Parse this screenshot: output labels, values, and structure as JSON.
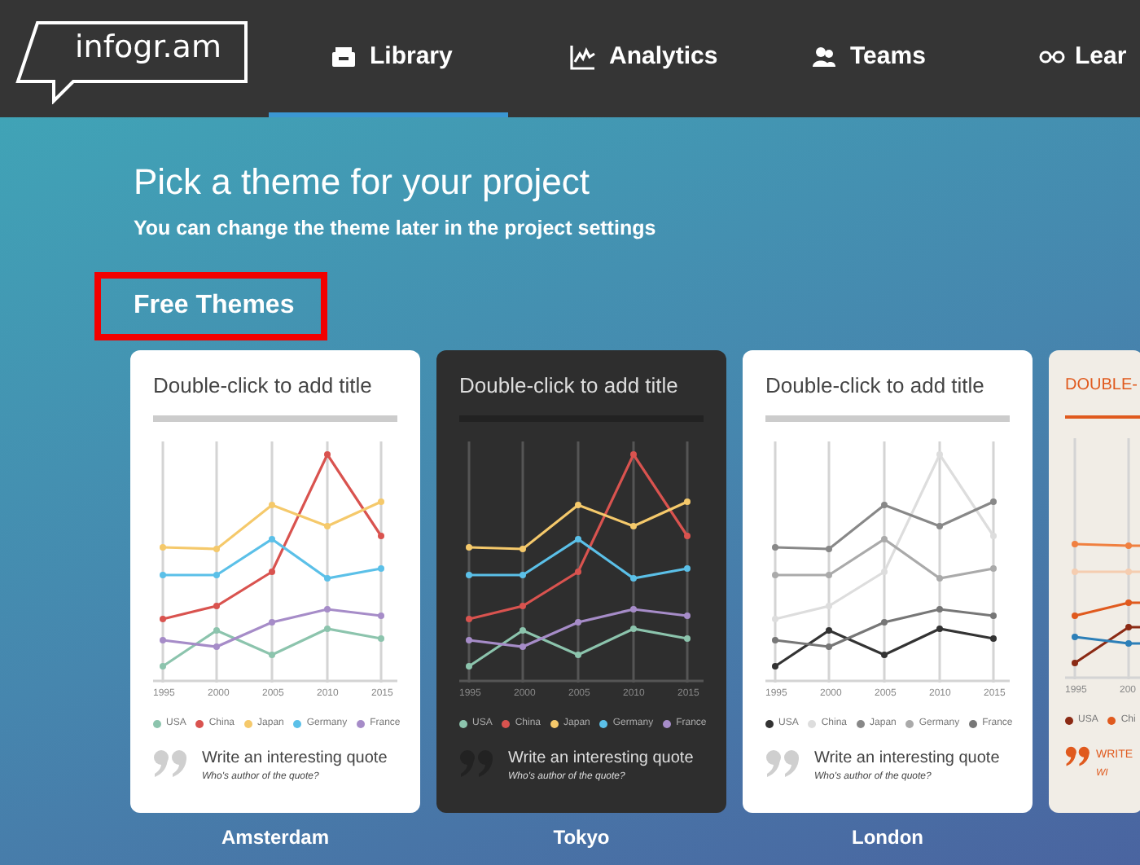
{
  "header": {
    "logo": "infogr.am",
    "nav": [
      {
        "label": "Library",
        "selected": true
      },
      {
        "label": "Analytics",
        "selected": false
      },
      {
        "label": "Teams",
        "selected": false
      },
      {
        "label": "Lear",
        "selected": false
      }
    ]
  },
  "page": {
    "title": "Pick a theme for your project",
    "subtitle": "You can change the theme later in the project settings",
    "section": "Free Themes"
  },
  "themes": [
    {
      "kind": "light",
      "name": "Amsterdam",
      "title": "Double-click to add title",
      "x_ticks": [
        "1995",
        "2000",
        "2005",
        "2010",
        "2015"
      ],
      "legend": [
        {
          "label": "USA",
          "color": "#8cc4ad"
        },
        {
          "label": "China",
          "color": "#d9534f"
        },
        {
          "label": "Japan",
          "color": "#f5c96b"
        },
        {
          "label": "Germany",
          "color": "#5bc0e8"
        },
        {
          "label": "France",
          "color": "#a68cc8"
        }
      ],
      "quote": "Write an interesting quote",
      "author": "Who's author of the quote?"
    },
    {
      "kind": "dark",
      "name": "Tokyo",
      "title": "Double-click to add title",
      "x_ticks": [
        "1995",
        "2000",
        "2005",
        "2010",
        "2015"
      ],
      "legend": [
        {
          "label": "USA",
          "color": "#8cc4ad"
        },
        {
          "label": "China",
          "color": "#d9534f"
        },
        {
          "label": "Japan",
          "color": "#f5c96b"
        },
        {
          "label": "Germany",
          "color": "#5bc0e8"
        },
        {
          "label": "France",
          "color": "#a68cc8"
        }
      ],
      "quote": "Write an interesting quote",
      "author": "Who's author of the quote?"
    },
    {
      "kind": "light",
      "name": "London",
      "title": "Double-click to add title",
      "x_ticks": [
        "1995",
        "2000",
        "2005",
        "2010",
        "2015"
      ],
      "legend": [
        {
          "label": "USA",
          "color": "#333333"
        },
        {
          "label": "China",
          "color": "#dddddd"
        },
        {
          "label": "Japan",
          "color": "#888888"
        },
        {
          "label": "Germany",
          "color": "#aaaaaa"
        },
        {
          "label": "France",
          "color": "#777777"
        }
      ],
      "quote": "Write an interesting quote",
      "author": "Who's author of the quote?"
    },
    {
      "kind": "cream",
      "title": "DOUBLE-",
      "x_ticks": [
        "1995",
        "200"
      ],
      "legend": [
        {
          "label": "USA",
          "color": "#8b2a14"
        },
        {
          "label": "Chi",
          "color": "#e05a1e"
        }
      ],
      "quote": "WRITE",
      "author": "WI"
    }
  ]
}
